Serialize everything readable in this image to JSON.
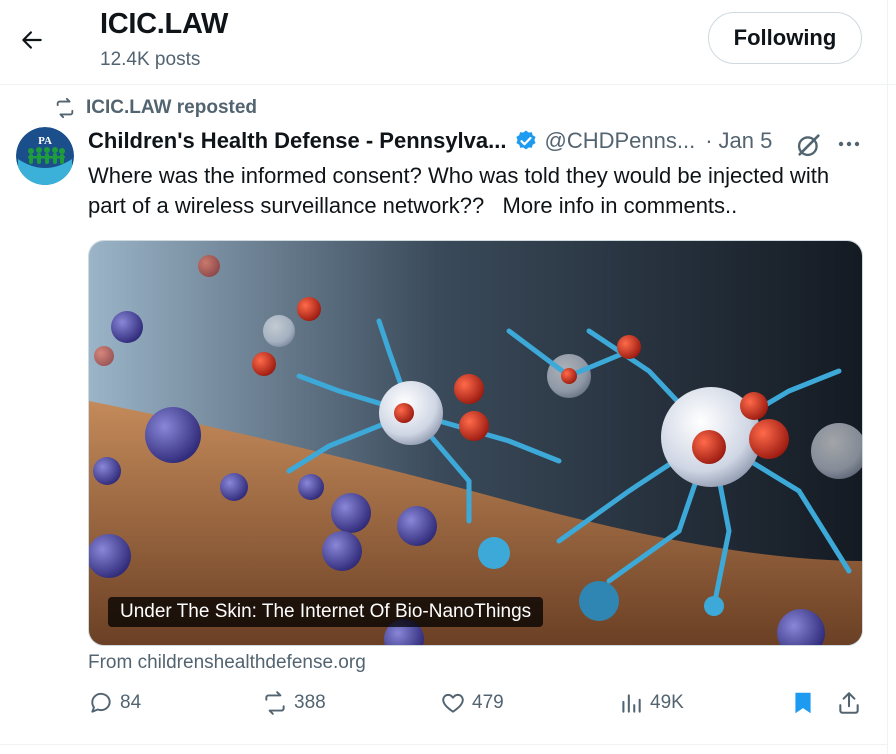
{
  "header": {
    "title": "ICIC.LAW",
    "posts_count": "12.4K posts",
    "follow_label": "Following"
  },
  "repost": {
    "label": "ICIC.LAW reposted"
  },
  "post": {
    "author_name": "Children's Health Defense - Pennsylva...",
    "handle": "@CHDPenns...",
    "separator": "·",
    "date": "Jan 5",
    "avatar_text": "PA",
    "text": "Where was the informed consent? Who was told they would be injected with part of a wireless surveillance network??   More info in comments..",
    "card": {
      "caption": "Under The Skin: The Internet Of Bio-NanoThings",
      "source": "From childrenshealthdefense.org"
    }
  },
  "actions": {
    "replies": "84",
    "reposts": "388",
    "likes": "479",
    "views": "49K"
  },
  "colors": {
    "accent": "#1d9bf0",
    "muted": "#536471",
    "text": "#0f1419"
  },
  "icons": {
    "back": "arrow-left-icon",
    "repost": "repost-icon",
    "verified": "verified-badge-icon",
    "grok": "grok-icon",
    "more": "more-dots-icon",
    "reply": "reply-icon",
    "like": "heart-icon",
    "views": "views-bar-icon",
    "bookmark": "bookmark-icon",
    "share": "share-icon"
  }
}
